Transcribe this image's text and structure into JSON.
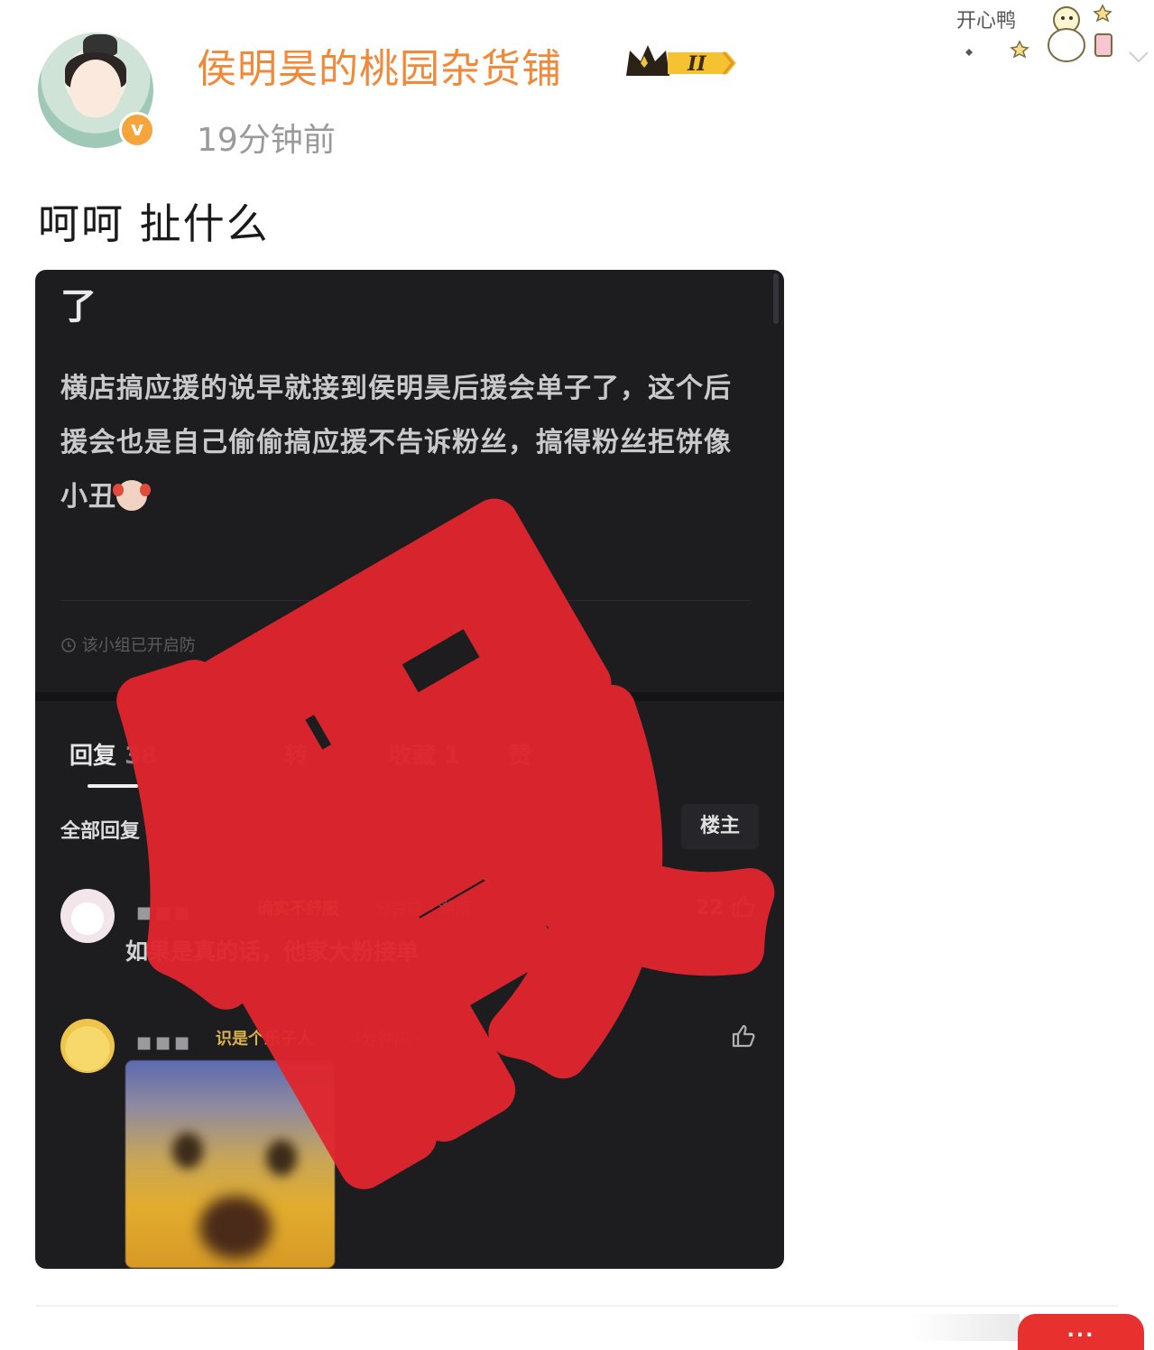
{
  "post": {
    "username": "侯明昊的桃园杂货铺",
    "member_level": "II",
    "timestamp": "19分钟前",
    "text": "呵呵 扯什么",
    "sticker_text": "开心鸭"
  },
  "embedded_screenshot": {
    "title": "了",
    "body": "横店搞应援的说早就接到侯明昊后援会单子了，这个后援会也是自己偷偷搞应援不告诉粉丝，搞得粉丝拒饼像小丑",
    "notice": "该小组已开启防",
    "tabs": [
      {
        "label": "回复",
        "count": "38"
      },
      {
        "label": "转"
      },
      {
        "label": "收藏",
        "count": "1"
      },
      {
        "label": "赞"
      }
    ],
    "all_replies_label": "全部回复",
    "op_button": "楼主",
    "comments": [
      {
        "name_dots": "■■■",
        "tag": "确实不舒服",
        "meta": "分钟前 · 湖南",
        "text": "如果是真的话，他家大粉接单",
        "likes": "22"
      },
      {
        "name_dots": "■■■",
        "tag": "识是个乐子人",
        "meta": "4分钟前 ·",
        "text": "",
        "likes": ""
      }
    ],
    "stamp_text": "假",
    "stamp_color": "#e0262e"
  },
  "footer": {
    "red_button": "..."
  },
  "colors": {
    "username": "#f08a3a",
    "verify_badge": "#f6a43c",
    "embed_bg": "#1d1d20",
    "stamp": "#e0262e"
  },
  "icons": [
    "verified-badge-icon",
    "crown-icon",
    "chevron-down-icon",
    "clown-emoji-icon",
    "thumb-up-icon",
    "notice-icon"
  ]
}
